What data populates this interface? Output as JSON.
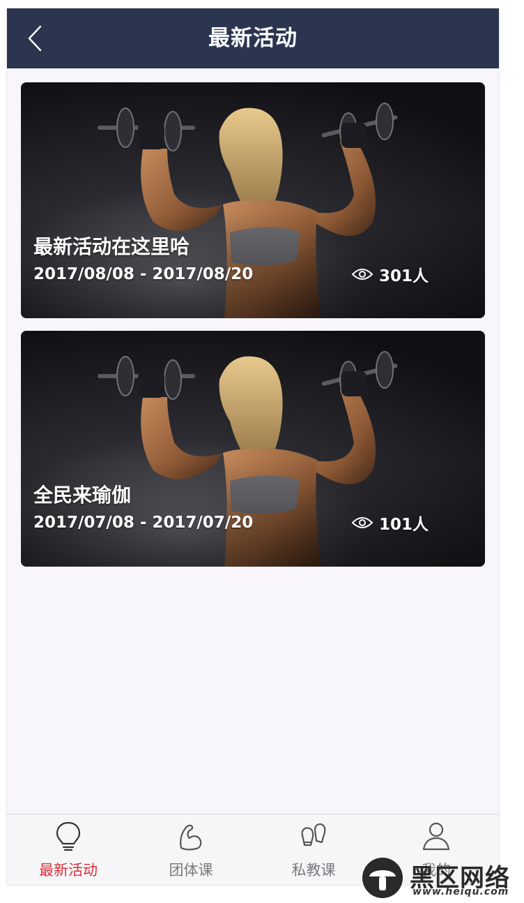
{
  "navbar": {
    "title": "最新活动",
    "back_icon": "chevron-left-icon",
    "background": "#2b3550"
  },
  "activities": [
    {
      "title": "最新活动在这里哈",
      "date_range": "2017/08/08 - 2017/08/20",
      "views": "301人",
      "views_icon": "eye-icon"
    },
    {
      "title": "全民来瑜伽",
      "date_range": "2017/07/08 - 2017/07/20",
      "views": "101人",
      "views_icon": "eye-icon"
    }
  ],
  "tabbar": {
    "tabs": [
      {
        "label": "最新活动",
        "icon": "lightbulb-icon",
        "active": true
      },
      {
        "label": "团体课",
        "icon": "flexed-arm-icon",
        "active": false
      },
      {
        "label": "私教课",
        "icon": "boxing-gloves-icon",
        "active": false
      },
      {
        "label": "我的",
        "icon": "user-icon",
        "active": false
      }
    ],
    "active_color": "#d9303c",
    "inactive_color": "#7a7a7e"
  },
  "watermark": {
    "text": "黑区网络",
    "url": "www.heiqu.com"
  }
}
